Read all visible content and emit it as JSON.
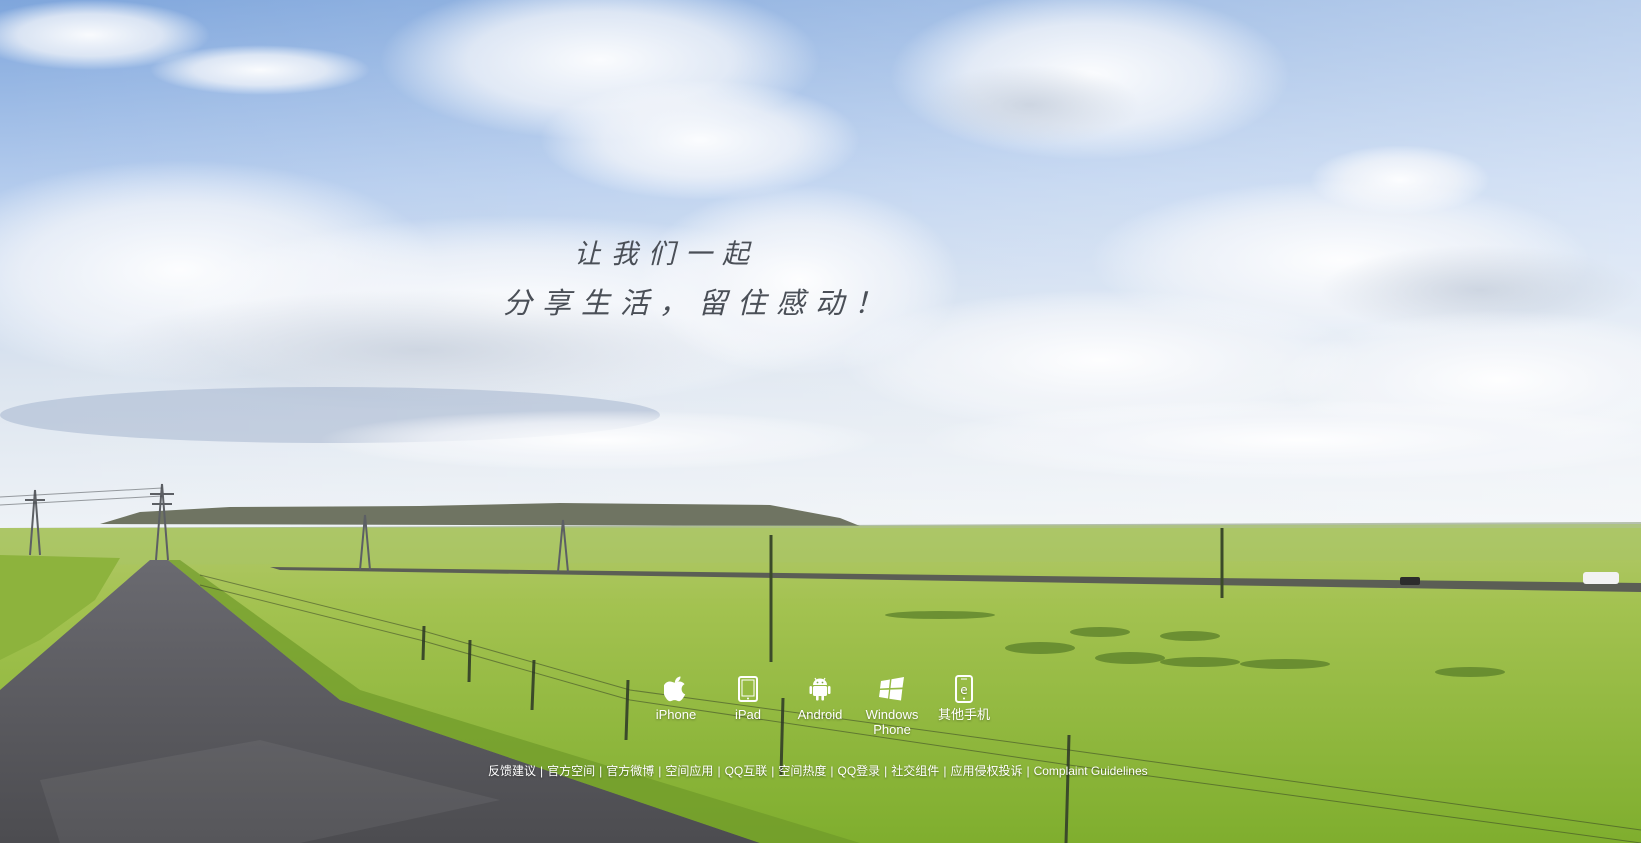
{
  "slogan": {
    "line1": "让我们一起",
    "line2": "分享生活，留住感动！"
  },
  "platforms": [
    {
      "label": "iPhone",
      "icon": "apple-icon"
    },
    {
      "label": "iPad",
      "icon": "tablet-icon"
    },
    {
      "label": "Android",
      "icon": "android-icon"
    },
    {
      "label": "Windows\nPhone",
      "icon": "windows-icon"
    },
    {
      "label": "其他手机",
      "icon": "mobile-phone-icon"
    }
  ],
  "footer": {
    "links": [
      "反馈建议",
      "官方空间",
      "官方微博",
      "空间应用",
      "QQ互联",
      "空间热度",
      "QQ登录",
      "社交组件",
      "应用侵权投诉",
      "Complaint Guidelines"
    ],
    "separator": "|"
  },
  "colors": {
    "sky_top": "#8fb4e4",
    "sky_bottom": "#e8eef5",
    "grass": "#9cc24a",
    "road": "#5a5a5e",
    "slogan": "#4a4f57"
  }
}
